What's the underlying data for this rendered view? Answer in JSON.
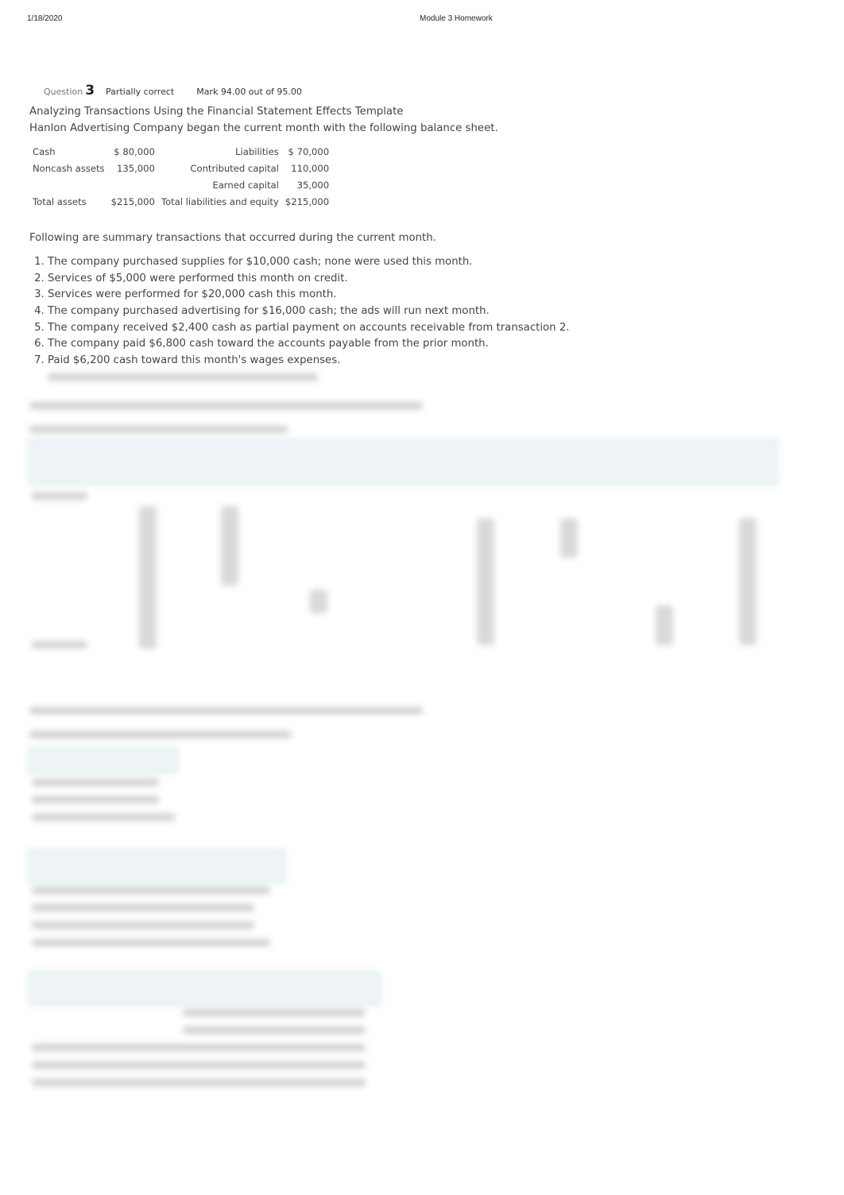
{
  "header": {
    "date": "1/18/2020",
    "title": "Module 3 Homework"
  },
  "question": {
    "label": "Question",
    "number": "3",
    "state": "Partially correct",
    "mark": "Mark 94.00 out of 95.00"
  },
  "intro": {
    "title": "Analyzing Transactions Using the Financial Statement Effects Template",
    "text": "Hanlon Advertising Company began the current month with the following balance sheet."
  },
  "balance_sheet": {
    "rows": [
      {
        "left_label": "Cash",
        "left_value": "$ 80,000",
        "right_label": "Liabilities",
        "right_value": "$ 70,000"
      },
      {
        "left_label": "Noncash assets",
        "left_value": "135,000",
        "right_label": "Contributed capital",
        "right_value": "110,000"
      },
      {
        "left_label": "",
        "left_value": "",
        "right_label": "Earned capital",
        "right_value": "35,000"
      },
      {
        "left_label": "Total assets",
        "left_value": "$215,000",
        "right_label": "Total liabilities and equity",
        "right_value": "$215,000"
      }
    ]
  },
  "transactions": {
    "intro": "Following are summary transactions that occurred during the current month.",
    "items": [
      "The company purchased supplies for $10,000 cash; none were used this month.",
      "Services of $5,000 were performed this month on credit.",
      "Services were performed for $20,000 cash this month.",
      "The company purchased advertising for $16,000 cash; the ads will run next month.",
      "The company received $2,400 cash as partial payment on accounts receivable from transaction 2.",
      "The company paid $6,800 cash toward the accounts payable from the prior month.",
      "Paid $6,200 cash toward this month's wages expenses."
    ]
  }
}
